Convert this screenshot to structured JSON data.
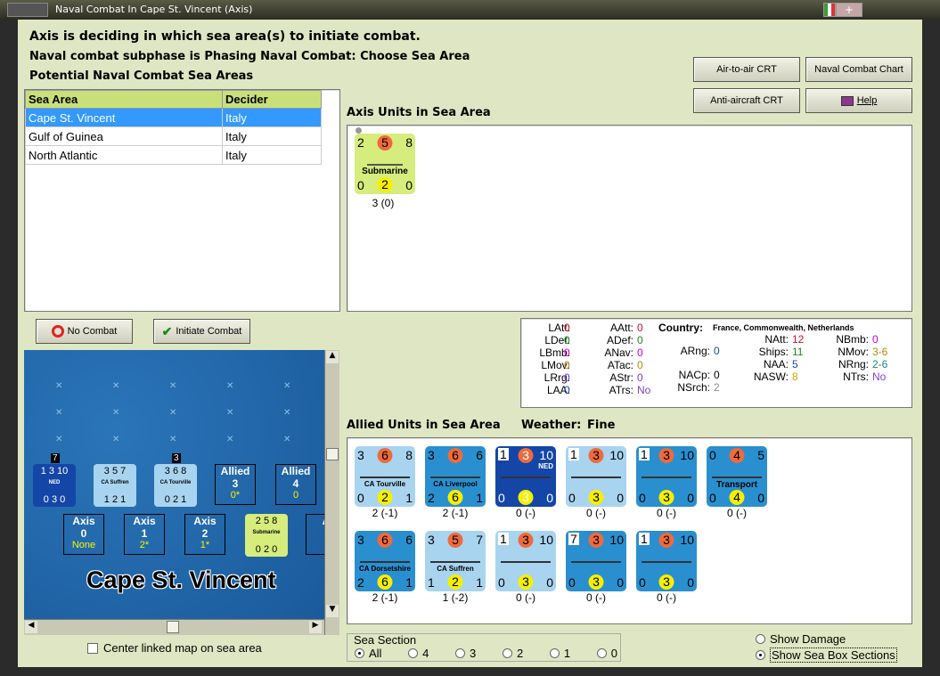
{
  "window": {
    "title": "Naval Combat In Cape St. Vincent (Axis)"
  },
  "header": {
    "line1": "Axis is deciding in which sea area(s) to initiate combat.",
    "line2": "Naval combat subphase is Phasing Naval Combat: Choose Sea Area",
    "line3": "Potential Naval Combat Sea Areas"
  },
  "buttons": {
    "air_to_air": "Air-to-air CRT",
    "naval_chart": "Naval Combat Chart",
    "anti_aircraft": "Anti-aircraft CRT",
    "help": "Help",
    "no_combat": "No Combat",
    "initiate_combat": "Initiate Combat"
  },
  "sea_table": {
    "headers": [
      "Sea Area",
      "Decider"
    ],
    "rows": [
      {
        "area": "Cape St. Vincent",
        "decider": "Italy",
        "selected": true
      },
      {
        "area": "Gulf of Guinea",
        "decider": "Italy"
      },
      {
        "area": "North Atlantic",
        "decider": "Italy"
      }
    ]
  },
  "axis_units": {
    "label": "Axis Units in Sea Area",
    "units": [
      {
        "tl": "2",
        "tc": "5",
        "tr": "8",
        "name": "Submarine",
        "bl": "0",
        "bc": "2",
        "br": "0",
        "caption": "3 (0)"
      }
    ]
  },
  "stats": {
    "country_label": "Country:",
    "country_value": "France, Commonwealth, Netherlands",
    "col1": [
      [
        "LAtt:",
        "0"
      ],
      [
        "LDef:",
        "0"
      ],
      [
        "LBmb:",
        "0"
      ],
      [
        "LMov:",
        "0"
      ],
      [
        "LRrg:",
        "0"
      ],
      [
        "LAA:",
        "0"
      ]
    ],
    "col2": [
      [
        "AAtt:",
        "0"
      ],
      [
        "ADef:",
        "0"
      ],
      [
        "ANav:",
        "0"
      ],
      [
        "ATac:",
        "0"
      ],
      [
        "AStr:",
        "0"
      ],
      [
        "ATrs:",
        "No"
      ]
    ],
    "col3": [
      [
        "ARng:",
        "0"
      ],
      [
        "NACp:",
        "0"
      ],
      [
        "NSrch:",
        "2"
      ]
    ],
    "col4": [
      [
        "NAtt:",
        "12"
      ],
      [
        "Ships:",
        "11"
      ],
      [
        "NAA:",
        "5"
      ],
      [
        "NASW:",
        "8"
      ]
    ],
    "col5": [
      [
        "NBmb:",
        "0"
      ],
      [
        "NMov:",
        "3-6"
      ],
      [
        "NRng:",
        "2-6"
      ],
      [
        "NTrs:",
        "No"
      ]
    ]
  },
  "allied": {
    "label": "Allied Units in Sea Area",
    "weather_label": "Weather:",
    "weather_value": "Fine",
    "row1": [
      {
        "tl": "3",
        "tc": "6",
        "tr": "8",
        "name": "CA Tourville",
        "bl": "0",
        "bc": "2",
        "br": "1",
        "color": "lb",
        "caption": "2 (-1)"
      },
      {
        "tl": "3",
        "tc": "6",
        "tr": "6",
        "name": "CA Liverpool",
        "bl": "2",
        "bc": "6",
        "br": "1",
        "color": "mb",
        "caption": "2 (-1)"
      },
      {
        "tl": "1",
        "tc": "3",
        "tr": "10",
        "name": "NED",
        "bl": "0",
        "bc": "3",
        "br": "0",
        "color": "db",
        "caption": "0 (-)"
      },
      {
        "tl": "1",
        "tc": "3",
        "tr": "10",
        "name": "",
        "bl": "0",
        "bc": "3",
        "br": "0",
        "color": "lb",
        "caption": "0 (-)"
      },
      {
        "tl": "1",
        "tc": "3",
        "tr": "10",
        "name": "",
        "bl": "0",
        "bc": "3",
        "br": "0",
        "color": "mb",
        "caption": "0 (-)"
      },
      {
        "tl": "0",
        "tc": "4",
        "tr": "5",
        "name": "Transport",
        "bl": "0",
        "bc": "4",
        "br": "0",
        "color": "mb",
        "caption": "0 (-)"
      }
    ],
    "row2": [
      {
        "tl": "3",
        "tc": "6",
        "tr": "6",
        "name": "CA Dorsetshire",
        "bl": "2",
        "bc": "6",
        "br": "1",
        "color": "mb",
        "caption": "2 (-1)"
      },
      {
        "tl": "3",
        "tc": "5",
        "tr": "7",
        "name": "CA Suffren",
        "bl": "1",
        "bc": "2",
        "br": "1",
        "color": "lb",
        "caption": "1 (-2)"
      },
      {
        "tl": "1",
        "tc": "3",
        "tr": "10",
        "name": "",
        "bl": "0",
        "bc": "3",
        "br": "0",
        "color": "lb",
        "caption": "0 (-)"
      },
      {
        "tl": "7",
        "tc": "3",
        "tr": "10",
        "name": "",
        "bl": "0",
        "bc": "3",
        "br": "0",
        "color": "mb",
        "caption": "0 (-)"
      },
      {
        "tl": "1",
        "tc": "3",
        "tr": "10",
        "name": "",
        "bl": "0",
        "bc": "3",
        "br": "0",
        "color": "mb",
        "caption": "0 (-)"
      }
    ]
  },
  "map": {
    "area_name": "Cape St. Vincent",
    "allied_boxes": [
      {
        "label": "Allied",
        "num": "3",
        "val": "0*"
      },
      {
        "label": "Allied",
        "num": "4",
        "val": "0"
      }
    ],
    "axis_boxes": [
      {
        "label": "Axis",
        "num": "0",
        "val": "None"
      },
      {
        "label": "Axis",
        "num": "1",
        "val": "2*"
      },
      {
        "label": "Axis",
        "num": "2",
        "val": "1*"
      },
      {
        "label": "A",
        "num": "",
        "val": ""
      }
    ],
    "counters": [
      {
        "top": "1 3 10",
        "name": "NED",
        "bottom": "0 3 0",
        "badge": "7"
      },
      {
        "top": "3 5 7",
        "name": "CA Suffren",
        "bottom": "1 2 1"
      },
      {
        "top": "3 6 8",
        "name": "CA Tourville",
        "bottom": "0 2 1",
        "badge": "3"
      },
      {
        "top": "2 5 8",
        "name": "Submarine",
        "bottom": "0 2 0"
      }
    ]
  },
  "center_linked": "Center linked map on sea area",
  "sea_section": {
    "label": "Sea Section",
    "options": [
      "All",
      "4",
      "3",
      "2",
      "1",
      "0"
    ],
    "selected": "All"
  },
  "show": {
    "damage": "Show Damage",
    "sections": "Show Sea Box Sections"
  }
}
